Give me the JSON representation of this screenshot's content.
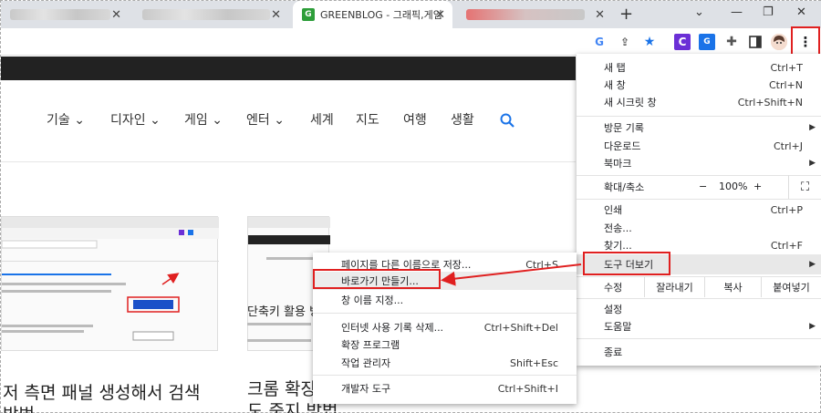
{
  "tabs": {
    "active_label": "GREENBLOG - 그래픽,게임",
    "active_favicon": "G",
    "new_tab": "+",
    "minimize": "—",
    "restore": "❐",
    "close": "✕"
  },
  "toolbar": {
    "icons": [
      "google-icon",
      "share-icon",
      "star-icon",
      "extension-c-icon",
      "translate-icon",
      "puzzle-icon",
      "sidepanel-icon",
      "profile-avatar",
      "menu-icon"
    ]
  },
  "nav": {
    "items": [
      {
        "label": "기술",
        "chevron": true
      },
      {
        "label": "디자인",
        "chevron": true
      },
      {
        "label": "게임",
        "chevron": true
      },
      {
        "label": "엔터",
        "chevron": true
      },
      {
        "label": "세계",
        "chevron": false
      },
      {
        "label": "지도",
        "chevron": false
      },
      {
        "label": "여행",
        "chevron": false
      },
      {
        "label": "생활",
        "chevron": false
      }
    ]
  },
  "articles": {
    "left_title_line1": "저 측면 패널 생성해서 검색",
    "left_title_line2": "방법",
    "right_title_line1": "크롬 확장",
    "right_title_line2": "도 중지 방법",
    "right_snippet": "단축키 활용 방법"
  },
  "main_menu": {
    "new_tab": {
      "label": "새 탭",
      "shortcut": "Ctrl+T"
    },
    "new_window": {
      "label": "새 창",
      "shortcut": "Ctrl+N"
    },
    "incognito": {
      "label": "새 시크릿 창",
      "shortcut": "Ctrl+Shift+N"
    },
    "history": {
      "label": "방문 기록"
    },
    "downloads": {
      "label": "다운로드",
      "shortcut": "Ctrl+J"
    },
    "bookmarks": {
      "label": "북마크"
    },
    "zoom": {
      "label": "확대/축소",
      "minus": "−",
      "value": "100%",
      "plus": "+"
    },
    "print": {
      "label": "인쇄",
      "shortcut": "Ctrl+P"
    },
    "cast": {
      "label": "전송..."
    },
    "find": {
      "label": "찾기...",
      "shortcut": "Ctrl+F"
    },
    "more_tools": {
      "label": "도구 더보기"
    },
    "edit": {
      "label": "수정",
      "cut": "잘라내기",
      "copy": "복사",
      "paste": "붙여넣기"
    },
    "settings": {
      "label": "설정"
    },
    "help": {
      "label": "도움말"
    },
    "exit": {
      "label": "종료"
    }
  },
  "sub_menu": {
    "save_page": {
      "label": "페이지를 다른 이름으로 저장...",
      "shortcut": "Ctrl+S"
    },
    "create_shortcut": {
      "label": "바로가기 만들기..."
    },
    "name_window": {
      "label": "창 이름 지정..."
    },
    "clear_data": {
      "label": "인터넷 사용 기록 삭제...",
      "shortcut": "Ctrl+Shift+Del"
    },
    "extensions": {
      "label": "확장 프로그램"
    },
    "task_manager": {
      "label": "작업 관리자",
      "shortcut": "Shift+Esc"
    },
    "dev_tools": {
      "label": "개발자 도구",
      "shortcut": "Ctrl+Shift+I"
    }
  },
  "colors": {
    "accent_red": "#e02020",
    "star_blue": "#1a73e8",
    "favicon_green": "#2e9e3a"
  }
}
